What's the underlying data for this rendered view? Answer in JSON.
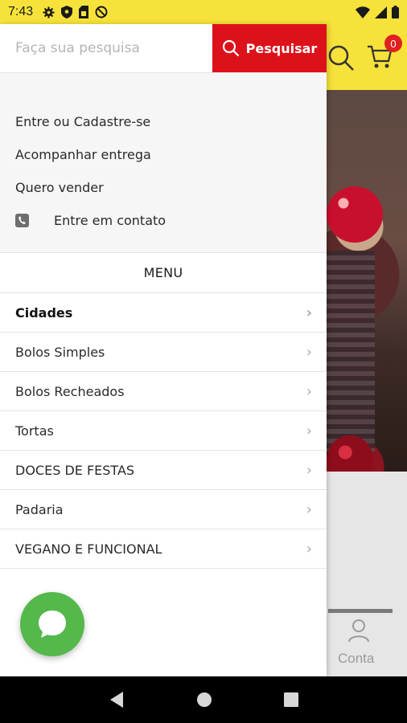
{
  "status_bar": {
    "time": "7:43",
    "left_icons": [
      "gear-icon",
      "shield-icon",
      "sim-icon",
      "no-disturb-icon"
    ],
    "right_icons": [
      "wifi-icon",
      "signal-icon",
      "battery-icon"
    ]
  },
  "search": {
    "placeholder": "Faça sua pesquisa",
    "button_label": "Pesquisar"
  },
  "account_links": [
    {
      "label": "Entre ou Cadastre-se"
    },
    {
      "label": "Acompanhar entrega"
    },
    {
      "label": "Quero vender"
    },
    {
      "label": "Entre em contato",
      "icon": "phone-icon"
    }
  ],
  "menu": {
    "title": "MENU",
    "items": [
      {
        "label": "Cidades"
      },
      {
        "label": "Bolos Simples"
      },
      {
        "label": "Bolos Recheados"
      },
      {
        "label": "Tortas"
      },
      {
        "label": "DOCES DE FESTAS"
      },
      {
        "label": "Padaria"
      },
      {
        "label": "VEGANO E FUNCIONAL"
      }
    ]
  },
  "background": {
    "cart_count": "0",
    "tab_label": "Conta"
  },
  "colors": {
    "brand_yellow": "#f6e23a",
    "search_red": "#dd1119",
    "chat_green": "#55b84a"
  }
}
